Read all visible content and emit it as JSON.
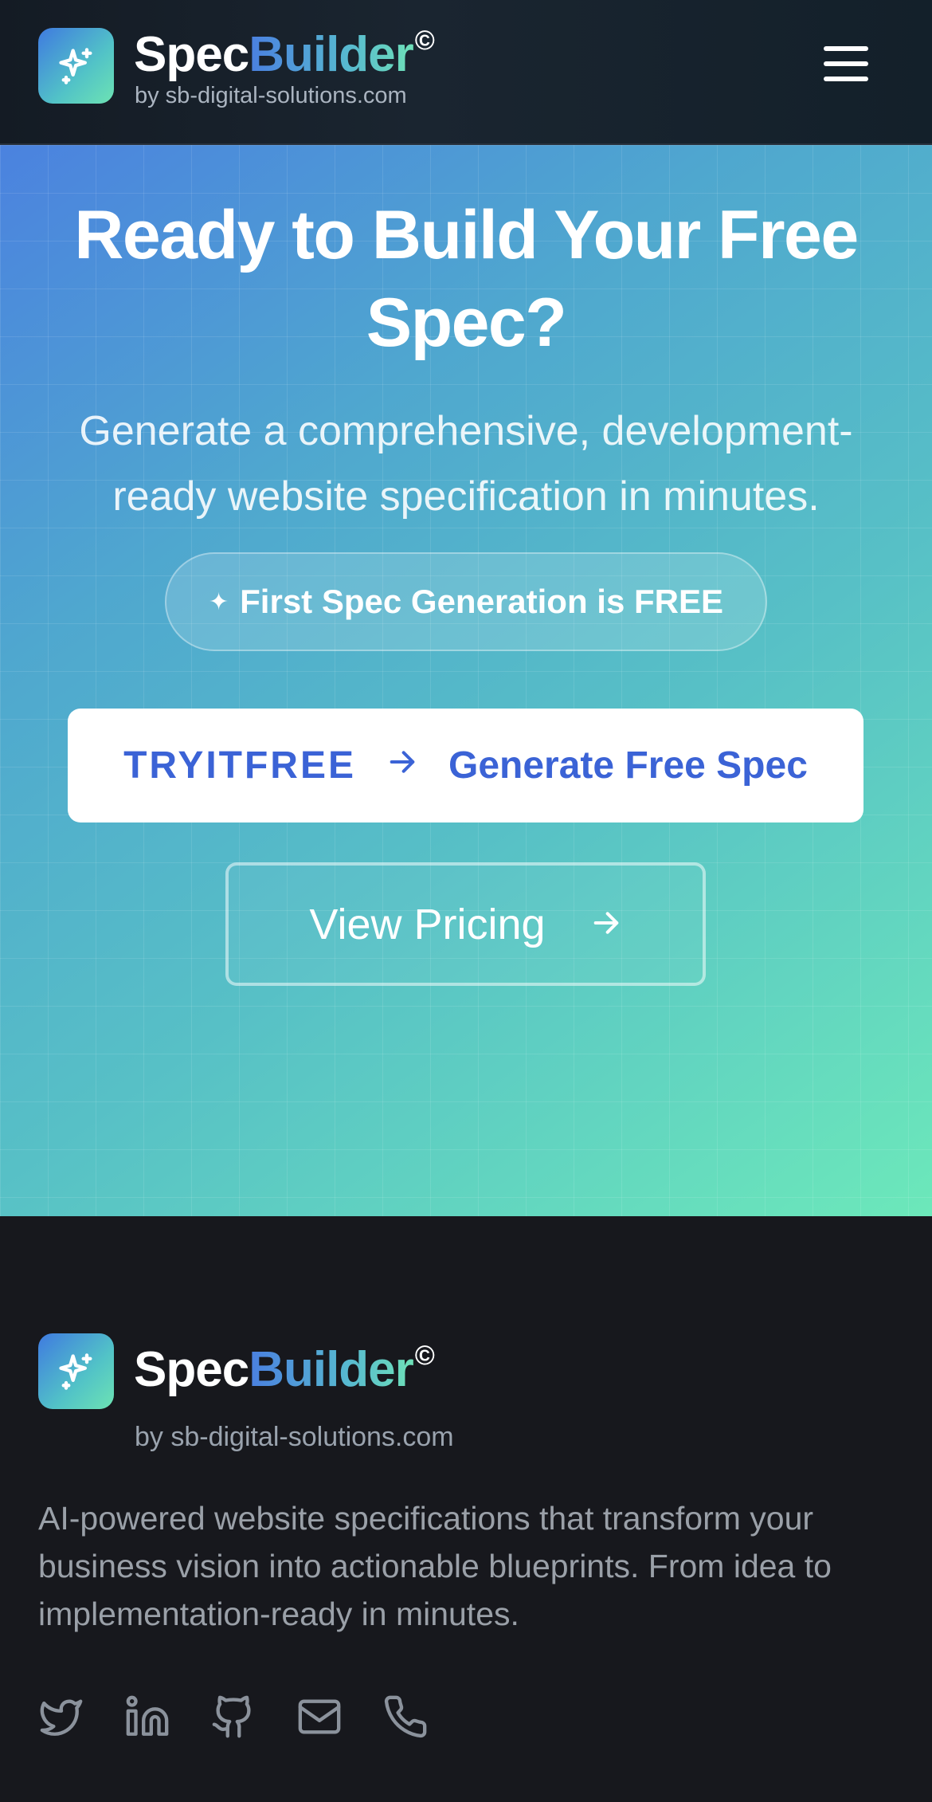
{
  "header": {
    "brand_part1": "Spec",
    "brand_part2": "Builder",
    "brand_mark": "©",
    "byline": "by sb-digital-solutions.com",
    "logo_icon": "sparkles-icon",
    "menu_icon": "hamburger-menu-icon"
  },
  "hero": {
    "title": "Ready to Build Your Free Spec?",
    "subtitle": "Generate a comprehensive, development-ready website specification in minutes.",
    "badge_icon": "sparkle-icon",
    "badge_text": "First Spec Generation is FREE",
    "primary_cta": {
      "code": "TRYITFREE",
      "arrow": "→",
      "label": "Generate Free Spec"
    },
    "secondary_cta": {
      "label": "View Pricing",
      "arrow": "→"
    }
  },
  "footer": {
    "brand_part1": "Spec",
    "brand_part2": "Builder",
    "brand_mark": "©",
    "byline": "by sb-digital-solutions.com",
    "description": "AI-powered website specifications that transform your business vision into actionable blueprints. From idea to implementation-ready in minutes.",
    "social_icons": [
      "twitter-icon",
      "linkedin-icon",
      "github-icon",
      "mail-icon",
      "phone-icon"
    ]
  },
  "colors": {
    "accent_blue": "#3b63d6",
    "gradient_start": "#4b82df",
    "gradient_end": "#6ce8ba",
    "header_bg": "#141b24",
    "footer_bg": "#17181d"
  }
}
